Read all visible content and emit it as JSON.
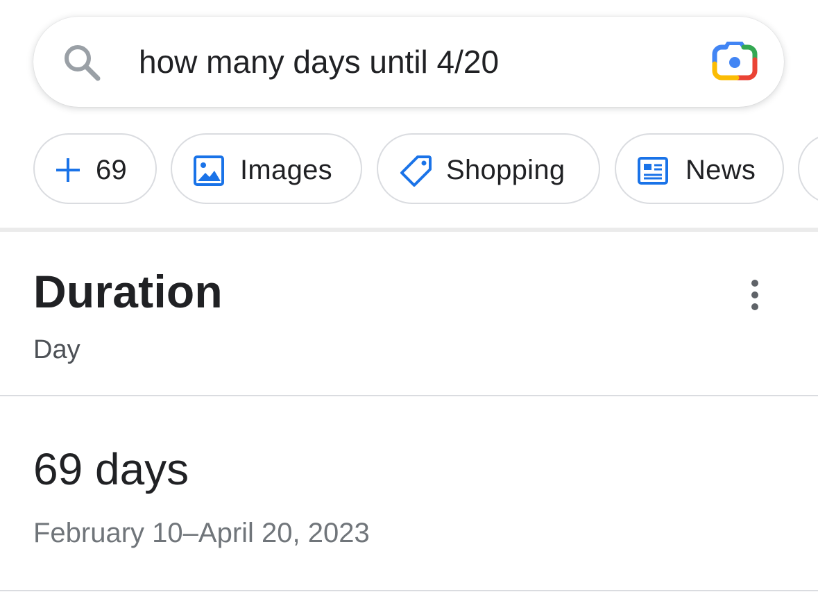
{
  "search": {
    "query": "how many days until 4/20",
    "icon": "search-icon",
    "lens_icon": "google-lens-camera-icon"
  },
  "chips": [
    {
      "label": "69",
      "icon": "plus-icon"
    },
    {
      "label": "Images",
      "icon": "image-icon"
    },
    {
      "label": "Shopping",
      "icon": "tag-icon"
    },
    {
      "label": "News",
      "icon": "newspaper-icon"
    }
  ],
  "card": {
    "title": "Duration",
    "subtitle": "Day",
    "more_icon": "more-vert-icon",
    "result": "69 days",
    "range": "February 10–April 20, 2023"
  },
  "colors": {
    "accent_blue": "#4285f4",
    "icon_blue": "#1a73e8",
    "text_primary": "#202124",
    "text_secondary": "#70757a",
    "chip_border": "#dadce0",
    "lens_red": "#ea4335",
    "lens_yellow": "#fbbc04",
    "lens_green": "#34a853"
  }
}
